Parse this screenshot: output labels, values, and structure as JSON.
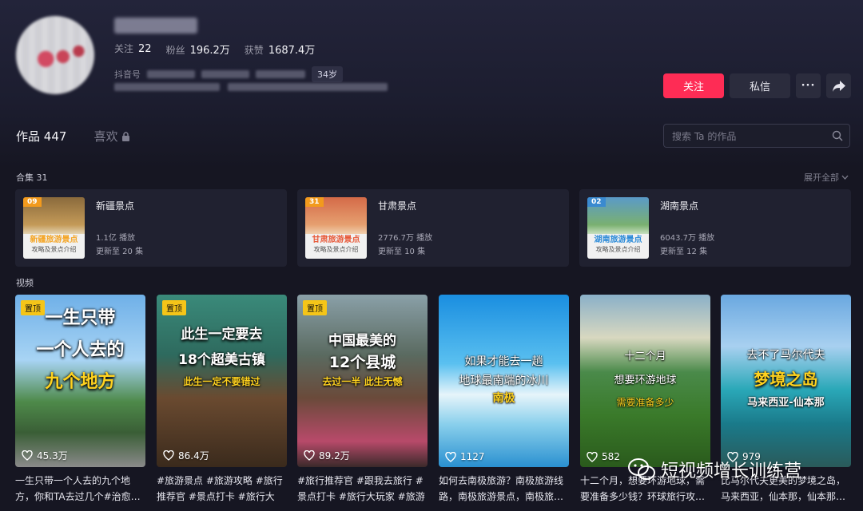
{
  "profile": {
    "stats": [
      {
        "label": "关注",
        "value": "22"
      },
      {
        "label": "粉丝",
        "value": "196.2万"
      },
      {
        "label": "获赞",
        "value": "1687.4万"
      }
    ],
    "douyin_label": "抖音号",
    "age": "34岁"
  },
  "actions": {
    "follow": "关注",
    "message": "私信",
    "more": "···"
  },
  "tabs": {
    "works_label": "作品",
    "works_count": "447",
    "likes_label": "喜欢"
  },
  "search": {
    "placeholder": "搜索 Ta 的作品"
  },
  "collections": {
    "title": "合集 31",
    "expand": "展开全部",
    "items": [
      {
        "num": "09",
        "title": "新疆景点",
        "cover_caption": "新疆旅游景点",
        "cover_sub": "攻略及景点介绍",
        "plays": "1.1亿 播放",
        "updated": "更新至 20 集"
      },
      {
        "num": "31",
        "title": "甘肃景点",
        "cover_caption": "甘肃旅游景点",
        "cover_sub": "攻略及景点介绍",
        "plays": "2776.7万 播放",
        "updated": "更新至 10 集"
      },
      {
        "num": "02",
        "title": "湖南景点",
        "cover_caption": "湖南旅游景点",
        "cover_sub": "攻略及景点介绍",
        "plays": "6043.7万 播放",
        "updated": "更新至 12 集"
      }
    ]
  },
  "videos": {
    "title": "视频",
    "pin_label": "置顶",
    "items": [
      {
        "pinned": true,
        "lines": [
          "一生只带",
          "一个人去的",
          "九个地方"
        ],
        "likes": "45.3万",
        "desc": "一生只带一个人去的九个地方，你和TA去过几个#治愈…"
      },
      {
        "pinned": true,
        "lines": [
          "此生一定要去",
          "18个超美古镇",
          "此生一定不要错过"
        ],
        "likes": "86.4万",
        "desc": "#旅游景点 #旅游攻略 #旅行推荐官 #景点打卡 #旅行大玩…"
      },
      {
        "pinned": true,
        "lines": [
          "中国最美的",
          "12个县城",
          "去过一半 此生无憾"
        ],
        "likes": "89.2万",
        "desc": "#旅行推荐官 #跟我去旅行 #景点打卡 #旅行大玩家 #旅游"
      },
      {
        "pinned": false,
        "lines": [
          "如果才能去一趟",
          "地球最南端的冰川",
          "南极"
        ],
        "likes": "1127",
        "desc": "如何去南极旅游？南极旅游线路，南极旅游景点，南极旅…"
      },
      {
        "pinned": false,
        "lines": [
          "十二个月",
          "想要环游地球",
          "需要准备多少"
        ],
        "likes": "582",
        "desc": "十二个月，想要环游地球，需要准备多少钱？环球旅行攻…"
      },
      {
        "pinned": false,
        "lines": [
          "去不了马尔代夫",
          "梦境之岛",
          "马来西亚-仙本那"
        ],
        "likes": "979",
        "desc": "比马尔代夫更美的梦境之岛，马来西亚，仙本那，仙本那…"
      }
    ]
  },
  "watermark": "短视频增长训练营",
  "colors": {
    "accent": "#fe2c55",
    "pin": "#f5c518",
    "bg": "#161622"
  }
}
